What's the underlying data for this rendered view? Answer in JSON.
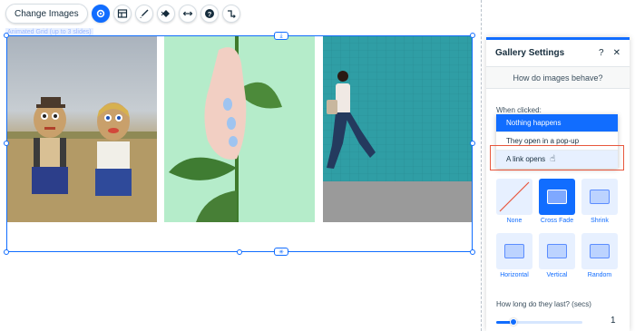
{
  "toolbar": {
    "change_images_label": "Change Images",
    "icons": [
      "settings-icon",
      "layout-icon",
      "design-icon",
      "animation-icon",
      "stretch-icon",
      "help-icon",
      "link-icon"
    ]
  },
  "gallery": {
    "selection_label": "Animated Grid (up to 3 slides)"
  },
  "panel": {
    "title": "Gallery Settings",
    "help": "?",
    "close": "✕",
    "section_title": "How do images behave?",
    "when_clicked_label": "When clicked:",
    "click_options": [
      "Nothing happens",
      "They open in a pop-up",
      "A link opens"
    ],
    "selected_option": "Nothing happens",
    "transitions": [
      {
        "label": "None"
      },
      {
        "label": "Cross Fade"
      },
      {
        "label": "Shrink"
      },
      {
        "label": "Horizontal"
      },
      {
        "label": "Vertical"
      },
      {
        "label": "Random"
      }
    ],
    "selected_transition": "Cross Fade",
    "duration_label": "How long do they last? (secs)",
    "duration_value": "1",
    "duration_fraction": 0.2
  },
  "colors": {
    "accent": "#116dff",
    "highlight": "#e8573d"
  }
}
